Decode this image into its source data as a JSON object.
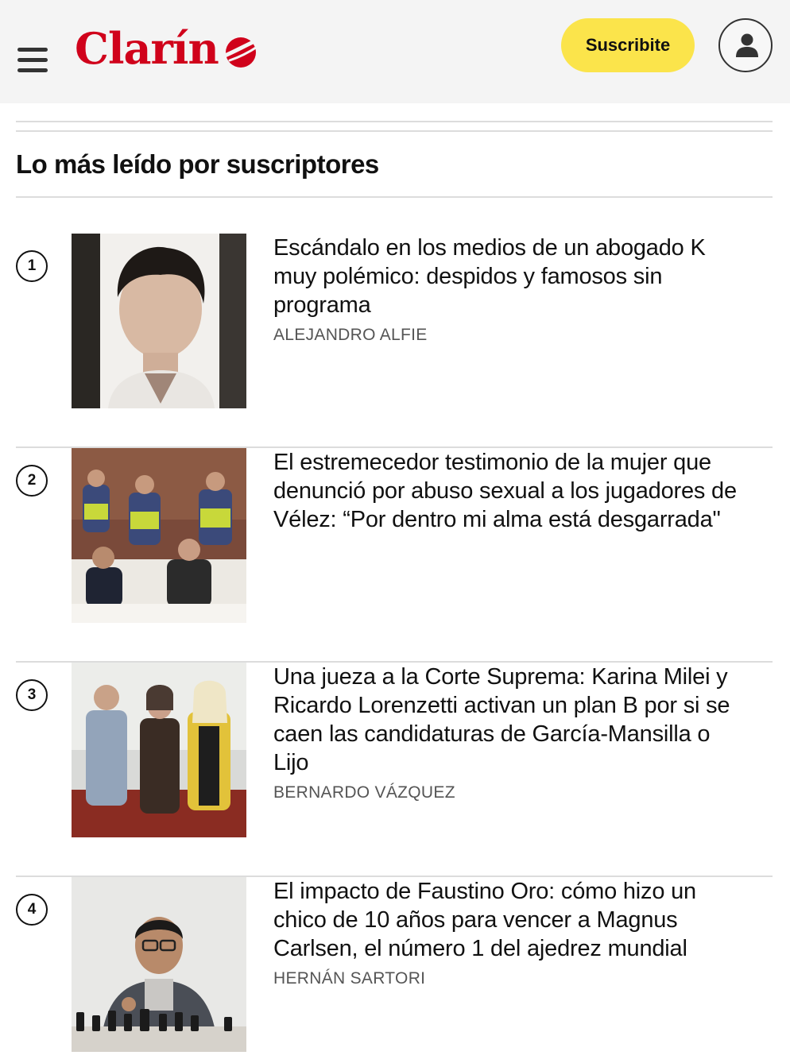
{
  "header": {
    "brand": "Clarín",
    "subscribe_label": "Suscribite"
  },
  "section": {
    "title": "Lo más leído por suscriptores"
  },
  "articles": [
    {
      "rank": "1",
      "headline": "Escándalo en los medios de un abogado K muy polémico: despidos y famosos sin programa",
      "author": "ALEJANDRO ALFIE"
    },
    {
      "rank": "2",
      "headline": "El estremecedor testimonio de la mujer que denunció por abuso sexual a los jugadores de Vélez: “Por dentro mi alma está desgarrada\"",
      "author": ""
    },
    {
      "rank": "3",
      "headline": "Una jueza a la Corte Suprema: Karina Milei y Ricardo Lorenzetti activan un plan B por si se caen las candidaturas de García-Mansilla o Lijo",
      "author": "BERNARDO VÁZQUEZ"
    },
    {
      "rank": "4",
      "headline": "El impacto de Faustino Oro: cómo hizo un chico de 10 años para vencer a Magnus Carlsen, el número 1 del ajedrez mundial",
      "author": "HERNÁN SARTORI"
    }
  ],
  "colors": {
    "brand_red": "#d0021b",
    "subscribe_yellow": "#fbe44b"
  },
  "icons": {
    "menu": "hamburger-icon",
    "user": "user-icon"
  }
}
